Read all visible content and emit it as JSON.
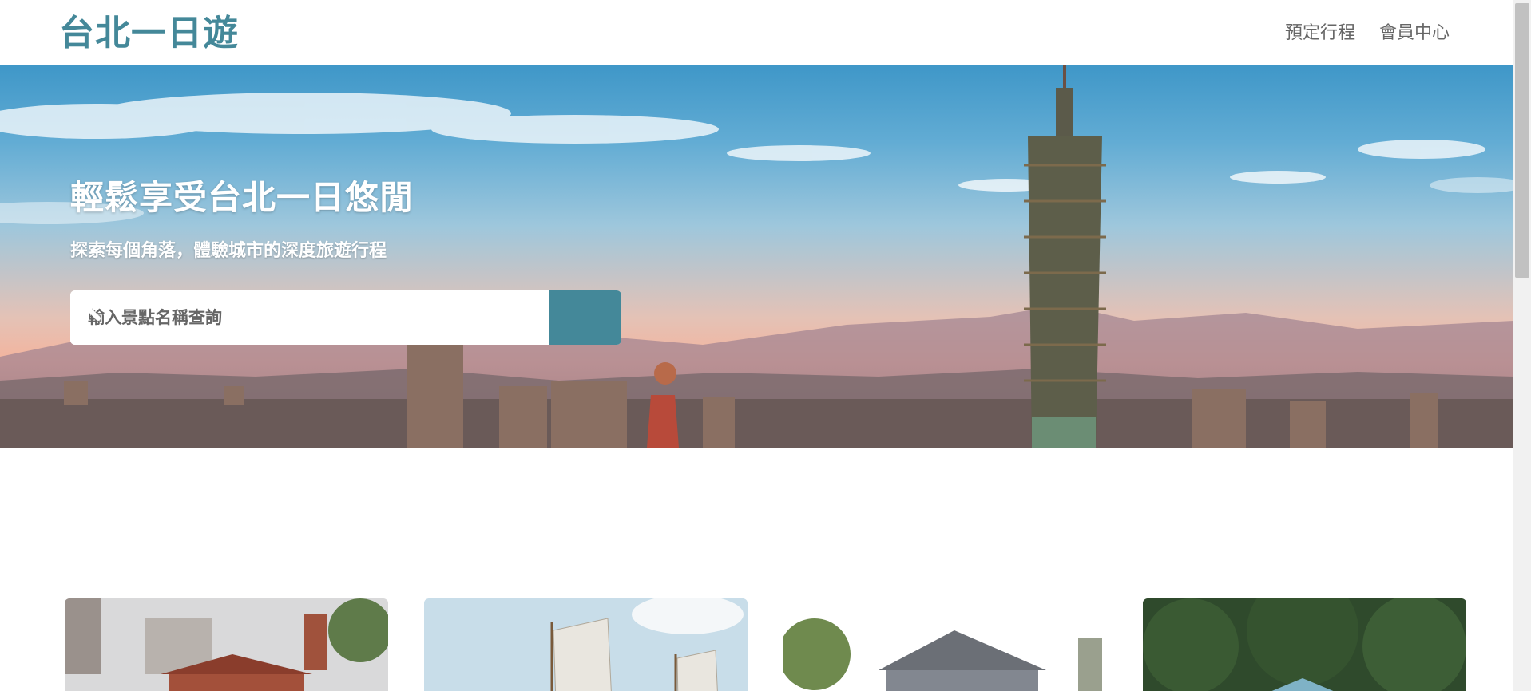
{
  "header": {
    "logo": "台北一日遊",
    "nav": [
      {
        "label": "預定行程"
      },
      {
        "label": "會員中心"
      }
    ]
  },
  "hero": {
    "title": "輕鬆享受台北一日悠閒",
    "subtitle": "探索每個角落，體驗城市的深度旅遊行程",
    "search": {
      "placeholder": "輸入景點名稱查詢",
      "value": "",
      "button_icon": "search-icon"
    }
  },
  "colors": {
    "brand": "#448899",
    "nav_text": "#666666"
  },
  "attractions": [
    {
      "image": "red-brick-building-photo"
    },
    {
      "image": "sailing-junk-photo"
    },
    {
      "image": "gray-roof-house-photo"
    },
    {
      "image": "green-forest-temple-photo"
    }
  ]
}
